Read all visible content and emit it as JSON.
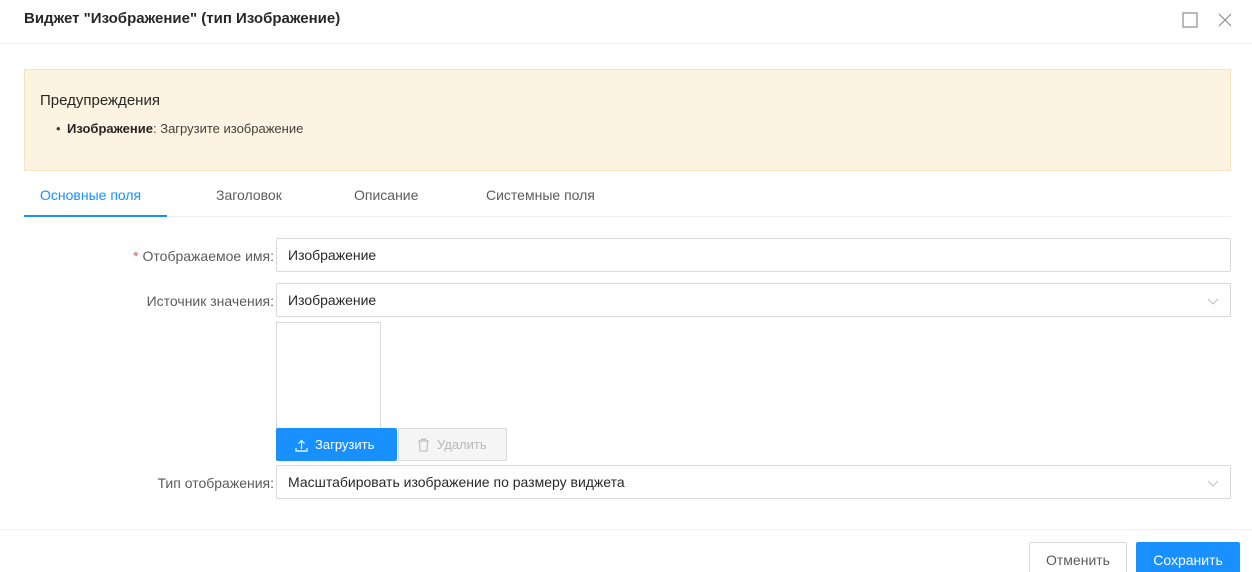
{
  "modal": {
    "title": "Виджет \"Изображение\" (тип Изображение)",
    "maximize_icon": "maximize-icon",
    "close_icon": "close-icon"
  },
  "warning": {
    "title": "Предупреждения",
    "items": [
      {
        "field": "Изображение",
        "separator": ":",
        "message": " Загрузите изображение"
      }
    ]
  },
  "tabs": [
    {
      "label": "Основные поля",
      "active": true
    },
    {
      "label": "Заголовок",
      "active": false
    },
    {
      "label": "Описание",
      "active": false
    },
    {
      "label": "Системные поля",
      "active": false
    }
  ],
  "form": {
    "display_name": {
      "required_mark": "*",
      "label": "Отображаемое имя:",
      "value": "Изображение"
    },
    "value_source": {
      "label": "Источник значения:",
      "value": "Изображение"
    },
    "image": {
      "upload_label": "Загрузить",
      "upload_icon": "upload-icon",
      "delete_label": "Удалить",
      "delete_icon": "trash-icon"
    },
    "display_type": {
      "label": "Тип отображения:",
      "value": "Масштабировать изображение по размеру виджета"
    }
  },
  "footer": {
    "cancel_label": "Отменить",
    "save_label": "Сохранить"
  },
  "colors": {
    "primary": "#1890ff",
    "warning_bg": "#fdf3e1",
    "required": "#ff4d4f"
  }
}
